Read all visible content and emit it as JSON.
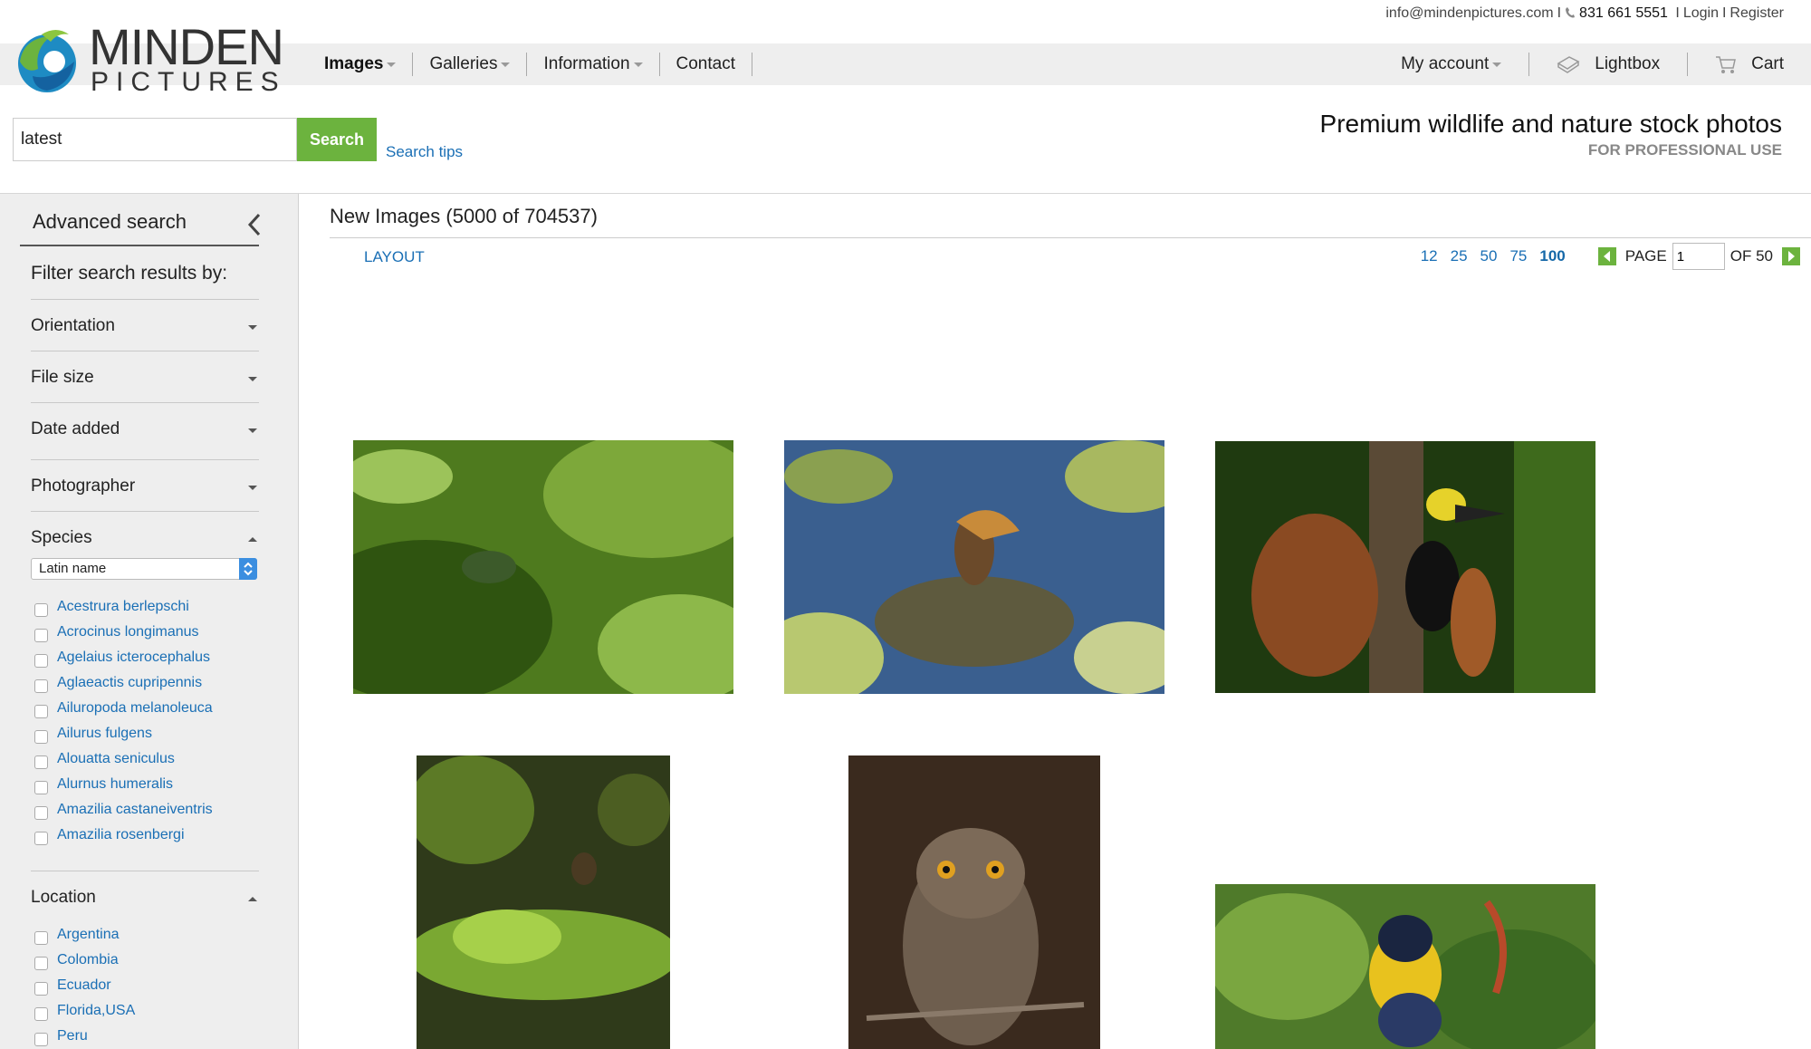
{
  "header": {
    "email": "info@mindenpictures.com",
    "phone": "831 661 5551",
    "login": "Login",
    "register": "Register",
    "logo_line1": "MINDEN",
    "logo_line2": "PICTURES",
    "tagline": "Premium wildlife and nature stock photos",
    "tagline_sub": "FOR PROFESSIONAL USE"
  },
  "nav": {
    "items": [
      {
        "label": "Images"
      },
      {
        "label": "Galleries"
      },
      {
        "label": "Information"
      },
      {
        "label": "Contact"
      }
    ],
    "account": "My account",
    "lightbox": "Lightbox",
    "cart": "Cart"
  },
  "search": {
    "value": "latest",
    "button": "Search",
    "tips": "Search tips"
  },
  "sidebar": {
    "title": "Advanced search",
    "filter_heading": "Filter search results by:",
    "facets": [
      "Orientation",
      "File size",
      "Date added",
      "Photographer",
      "Species",
      "Location"
    ],
    "species_select": "Latin name",
    "species": [
      "Acestrura berlepschi",
      "Acrocinus longimanus",
      "Agelaius icterocephalus",
      "Aglaeactis cupripennis",
      "Ailuropoda melanoleuca",
      "Ailurus fulgens",
      "Alouatta seniculus",
      "Alurnus humeralis",
      "Amazilia castaneiventris",
      "Amazilia rosenbergi"
    ],
    "locations": [
      "Argentina",
      "Colombia",
      "Ecuador",
      "Florida,USA",
      "Peru"
    ]
  },
  "main": {
    "title": "New Images (5000 of 704537)",
    "layout": "LAYOUT",
    "per_page": [
      "12",
      "25",
      "50",
      "75",
      "100"
    ],
    "per_page_active": "100",
    "page_label": "PAGE",
    "page_value": "1",
    "page_of": "OF 50"
  },
  "colors": {
    "accent_green": "#6cb33e",
    "link_blue": "#1a6fb5",
    "sidebar_bg": "#eeeeee"
  }
}
